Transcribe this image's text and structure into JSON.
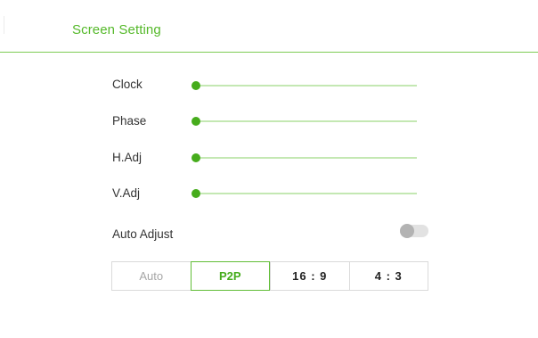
{
  "header": {
    "title": "Screen Setting"
  },
  "sliders": [
    {
      "label": "Clock",
      "value": 0
    },
    {
      "label": "Phase",
      "value": 0
    },
    {
      "label": "H.Adj",
      "value": 0
    },
    {
      "label": "V.Adj",
      "value": 0
    }
  ],
  "auto_adjust": {
    "label": "Auto Adjust",
    "enabled": false
  },
  "aspect": {
    "options": [
      "Auto",
      "P2P",
      "16 : 9",
      "4 : 3"
    ],
    "selected": "P2P"
  },
  "colors": {
    "accent": "#46ac1c",
    "track": "#c4e8b3",
    "divider": "#7fcc56",
    "toggle_off": "#b3b3b3"
  }
}
